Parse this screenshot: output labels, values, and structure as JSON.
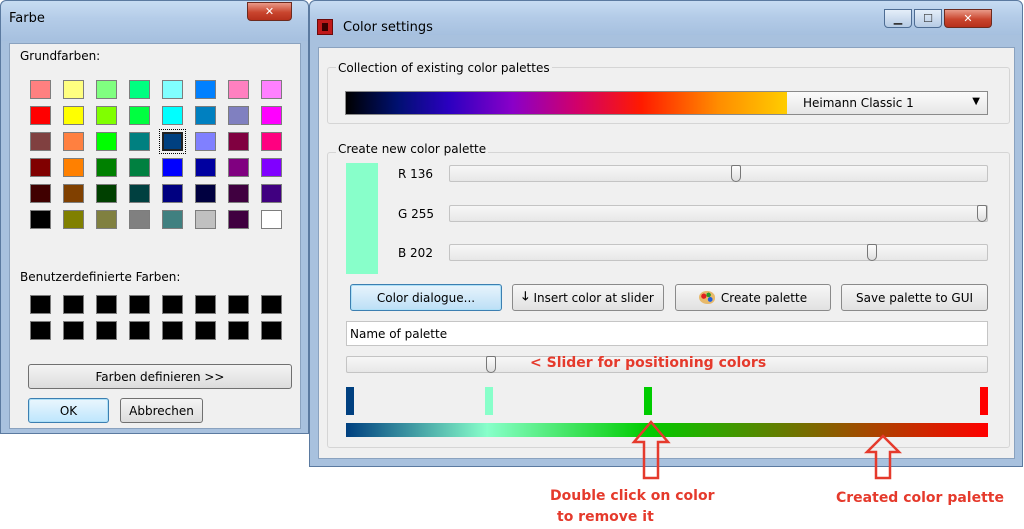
{
  "farbe_dialog": {
    "title": "Farbe",
    "close_icon": "close-icon",
    "basic_colors_label": "Grundfarben:",
    "basic_colors": [
      [
        "#ff8080",
        "#ffff80",
        "#80ff80",
        "#00ff80",
        "#80ffff",
        "#0080ff",
        "#ff80c0",
        "#ff80ff"
      ],
      [
        "#ff0000",
        "#ffff00",
        "#80ff00",
        "#00ff40",
        "#00ffff",
        "#0080c0",
        "#8080c0",
        "#ff00ff"
      ],
      [
        "#804040",
        "#ff8040",
        "#00ff00",
        "#008080",
        "#004080",
        "#8080ff",
        "#800040",
        "#ff0080"
      ],
      [
        "#800000",
        "#ff8000",
        "#008000",
        "#008040",
        "#0000ff",
        "#0000a0",
        "#800080",
        "#8000ff"
      ],
      [
        "#400000",
        "#804000",
        "#004000",
        "#004040",
        "#000080",
        "#000040",
        "#400040",
        "#400080"
      ],
      [
        "#000000",
        "#808000",
        "#808040",
        "#808080",
        "#408080",
        "#c0c0c0",
        "#400040",
        "#ffffff"
      ]
    ],
    "selected_basic_color": "#004080",
    "custom_colors_label": "Benutzerdefinierte Farben:",
    "custom_colors": [
      [
        "#000000",
        "#000000",
        "#000000",
        "#000000",
        "#000000",
        "#000000",
        "#000000",
        "#000000"
      ],
      [
        "#000000",
        "#000000",
        "#000000",
        "#000000",
        "#000000",
        "#000000",
        "#000000",
        "#000000"
      ]
    ],
    "define_colors_button": "Farben definieren >>",
    "ok_button": "OK",
    "cancel_button": "Abbrechen"
  },
  "color_settings": {
    "title": "Color settings",
    "app_icon": "app-icon",
    "minimize_icon": "minimize-icon",
    "maximize_icon": "maximize-icon",
    "close_icon": "close-icon",
    "existing_group_label": "Collection of existing color palettes",
    "palette_select_value": "Heimann Classic 1",
    "dropdown_icon": "chevron-down-icon",
    "new_group_label": "Create new color palette",
    "preview_color": "#88ffca",
    "sliders": [
      {
        "label": "R 136",
        "value": 136,
        "max": 255
      },
      {
        "label": "G 255",
        "value": 255,
        "max": 255
      },
      {
        "label": "B 202",
        "value": 202,
        "max": 255
      }
    ],
    "buttons": {
      "color_dialogue": "Color dialogue...",
      "insert_color": "Insert color at slider",
      "create_palette": "Create palette",
      "save_palette": "Save palette to GUI"
    },
    "insert_icon": "arrow-down-icon",
    "palette_icon": "palette-icon",
    "palette_name_value": "Name of palette",
    "position_slider_fraction": 0.22,
    "color_markers": [
      {
        "color": "#004080",
        "position": 0.0
      },
      {
        "color": "#88ffca",
        "position": 0.22
      },
      {
        "color": "#00cc00",
        "position": 0.47
      },
      {
        "color": "#ff0000",
        "position": 1.0
      }
    ]
  },
  "annotations": {
    "slider_note": "< Slider for positioning colors",
    "double_click_line1": "Double click on color",
    "double_click_line2": "to remove it",
    "created_palette": "Created color palette"
  }
}
